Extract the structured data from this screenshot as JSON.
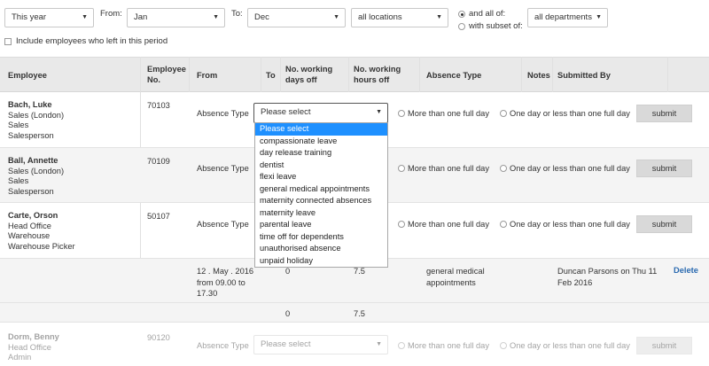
{
  "filters": {
    "period": "This year",
    "from_label": "From:",
    "from_month": "Jan",
    "to_label": "To:",
    "to_month": "Dec",
    "location": "all locations",
    "radio_all": "and all of:",
    "radio_subset": "with subset of:",
    "department": "all departments",
    "include_left": "Include employees who left in this period"
  },
  "headers": {
    "employee": "Employee",
    "employee_no_1": "Employee",
    "employee_no_2": "No.",
    "from": "From",
    "to": "To",
    "days_off_1": "No. working",
    "days_off_2": "days off",
    "hours_off_1": "No. working",
    "hours_off_2": "hours off",
    "absence_type": "Absence Type",
    "notes": "Notes",
    "submitted_by": "Submitted By"
  },
  "row_labels": {
    "absence_type": "Absence Type",
    "more_than": "More than one full day",
    "one_or_less": "One day or less than one full day",
    "submit": "submit",
    "select_placeholder": "Please select",
    "delete": "Delete"
  },
  "employees": [
    {
      "name": "Bach, Luke",
      "line2": "Sales (London)",
      "line3": "Sales",
      "line4": "Salesperson",
      "number": "70103"
    },
    {
      "name": "Ball, Annette",
      "line2": "Sales (London)",
      "line3": "Sales",
      "line4": "Salesperson",
      "number": "70109"
    },
    {
      "name": "Carte, Orson",
      "line2": "Head Office",
      "line3": "Warehouse",
      "line4": "Warehouse Picker",
      "number": "50107"
    },
    {
      "name": "Dorm, Benny",
      "line2": "Head Office",
      "line3": "Admin",
      "line4": "",
      "number": "90120"
    }
  ],
  "absence_record": {
    "from_line1": "12 . May . 2016",
    "from_line2": "from 09.00 to",
    "from_line3": "17.30",
    "days": "0",
    "hours": "7.5",
    "type_line1": "general medical",
    "type_line2": "appointments",
    "submitted_line1": "Duncan Parsons on Thu 11",
    "submitted_line2": "Feb 2016"
  },
  "totals": {
    "days": "0",
    "hours": "7.5"
  },
  "dropdown_options": [
    "Please select",
    "compassionate leave",
    "day release training",
    "dentist",
    "flexi leave",
    "general medical appointments",
    "maternity connected absences",
    "maternity leave",
    "parental leave",
    "time off for dependents",
    "unauthorised absence",
    "unpaid holiday"
  ]
}
